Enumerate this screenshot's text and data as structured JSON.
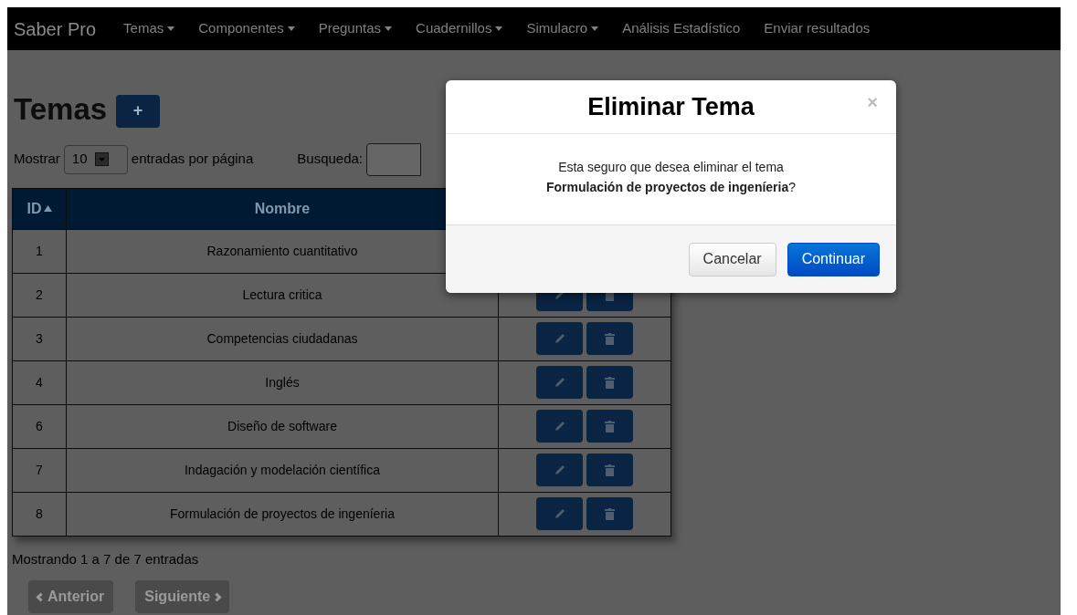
{
  "navbar": {
    "brand": "Saber Pro",
    "items": [
      {
        "label": "Temas",
        "dropdown": true
      },
      {
        "label": "Componentes",
        "dropdown": true
      },
      {
        "label": "Preguntas",
        "dropdown": true
      },
      {
        "label": "Cuadernillos",
        "dropdown": true
      },
      {
        "label": "Simulacro",
        "dropdown": true
      },
      {
        "label": "Análisis Estadístico",
        "dropdown": false
      },
      {
        "label": "Enviar resultados",
        "dropdown": false
      }
    ]
  },
  "page": {
    "title": "Temas",
    "add_button": "+",
    "length": {
      "before": "Mostrar",
      "value": "10",
      "after": "entradas por página"
    },
    "search": {
      "label": "Busqueda:"
    },
    "table": {
      "columns": [
        {
          "label": "ID",
          "sorted": true
        },
        {
          "label": "Nombre",
          "sorted": false
        }
      ],
      "rows": [
        {
          "id": "1",
          "name": "Razonamiento cuantitativo"
        },
        {
          "id": "2",
          "name": "Lectura critica"
        },
        {
          "id": "3",
          "name": "Competencias ciudadanas"
        },
        {
          "id": "4",
          "name": "Inglés"
        },
        {
          "id": "6",
          "name": "Diseño de software"
        },
        {
          "id": "7",
          "name": "Indagación y modelación científica"
        },
        {
          "id": "8",
          "name": "Formulación de proyectos de ingeníeria"
        }
      ]
    },
    "info": "Mostrando 1 a 7 de 7 entradas",
    "pagination": [
      {
        "label": "Anterior",
        "kind": "prev",
        "disabled": true
      },
      {
        "label": "Siguiente",
        "kind": "next",
        "disabled": true
      }
    ]
  },
  "modal": {
    "title": "Eliminar Tema",
    "close": "×",
    "message": [
      "Esta seguro que desea eliminar el tema",
      "**Formulación de proyectos de ingeníeria**?"
    ],
    "buttons": [
      {
        "label": "Cancelar",
        "kind": "default"
      },
      {
        "label": "Continuar",
        "kind": "primary"
      }
    ]
  }
}
